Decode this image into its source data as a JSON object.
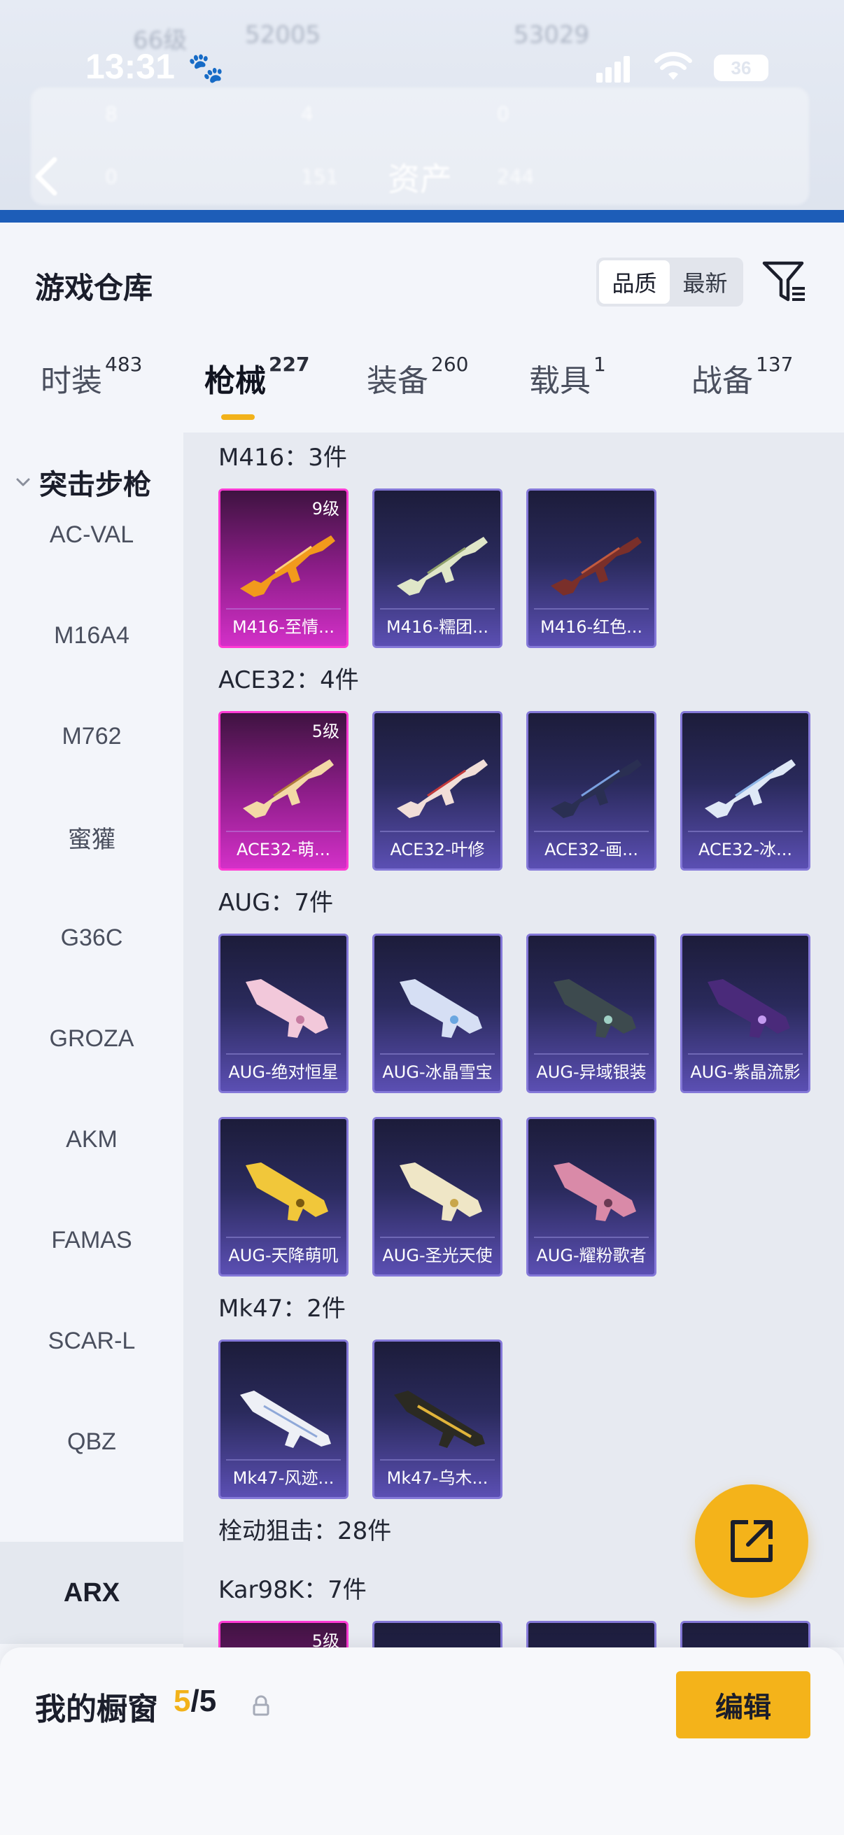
{
  "status_bar": {
    "time": "13:31",
    "battery": "36"
  },
  "header_bg": {
    "title": "资产",
    "ghost_level": "66级",
    "ghost_score": "52005",
    "ghost_right": "53029",
    "ghost_stats": [
      "8",
      "4",
      "0",
      "0",
      "151",
      "244"
    ]
  },
  "sheet": {
    "title": "游戏仓库",
    "sort_options": [
      "品质",
      "最新"
    ],
    "sort_active": "品质"
  },
  "tabs": [
    {
      "label": "时装",
      "count": "483"
    },
    {
      "label": "枪械",
      "count": "227"
    },
    {
      "label": "装备",
      "count": "260"
    },
    {
      "label": "载具",
      "count": "1"
    },
    {
      "label": "战备",
      "count": "137"
    }
  ],
  "sidebar": {
    "category": "突击步枪",
    "items": [
      "AC-VAL",
      "M16A4",
      "M762",
      "蜜獾",
      "G36C",
      "GROZA",
      "AKM",
      "FAMAS",
      "SCAR-L",
      "QBZ"
    ],
    "active_item": "ARX"
  },
  "groups": [
    {
      "label": "M416：3件",
      "items": [
        {
          "name": "M416-至情...",
          "level": "9级",
          "rarity": "pink"
        },
        {
          "name": "M416-糯团...",
          "rarity": "purple"
        },
        {
          "name": "M416-红色...",
          "rarity": "purple"
        }
      ]
    },
    {
      "label": "ACE32：4件",
      "items": [
        {
          "name": "ACE32-萌...",
          "level": "5级",
          "rarity": "pink"
        },
        {
          "name": "ACE32-叶修",
          "rarity": "purple"
        },
        {
          "name": "ACE32-画...",
          "rarity": "purple"
        },
        {
          "name": "ACE32-冰...",
          "rarity": "purple"
        }
      ]
    },
    {
      "label": "AUG：7件",
      "items": [
        {
          "name": "AUG-绝对恒星",
          "rarity": "purple"
        },
        {
          "name": "AUG-冰晶雪宝",
          "rarity": "purple"
        },
        {
          "name": "AUG-异域银装",
          "rarity": "purple"
        },
        {
          "name": "AUG-紫晶流影",
          "rarity": "purple"
        },
        {
          "name": "AUG-天降萌叽",
          "rarity": "purple"
        },
        {
          "name": "AUG-圣光天使",
          "rarity": "purple"
        },
        {
          "name": "AUG-耀粉歌者",
          "rarity": "purple"
        }
      ]
    },
    {
      "label": "Mk47：2件",
      "items": [
        {
          "name": "Mk47-风迹...",
          "rarity": "purple"
        },
        {
          "name": "Mk47-乌木...",
          "rarity": "purple"
        }
      ]
    }
  ],
  "section_bolt": "栓动狙击：28件",
  "group_kar98k": {
    "label": "Kar98K：7件",
    "first_level": "5级"
  },
  "bottom_bar": {
    "label": "我的橱窗",
    "current": "5",
    "separator": "/",
    "total": "5",
    "edit_label": "编辑"
  },
  "colors": {
    "accent": "#f4b31a",
    "pink_rarity": "#d330c8",
    "purple_rarity": "#5b4fb3"
  }
}
